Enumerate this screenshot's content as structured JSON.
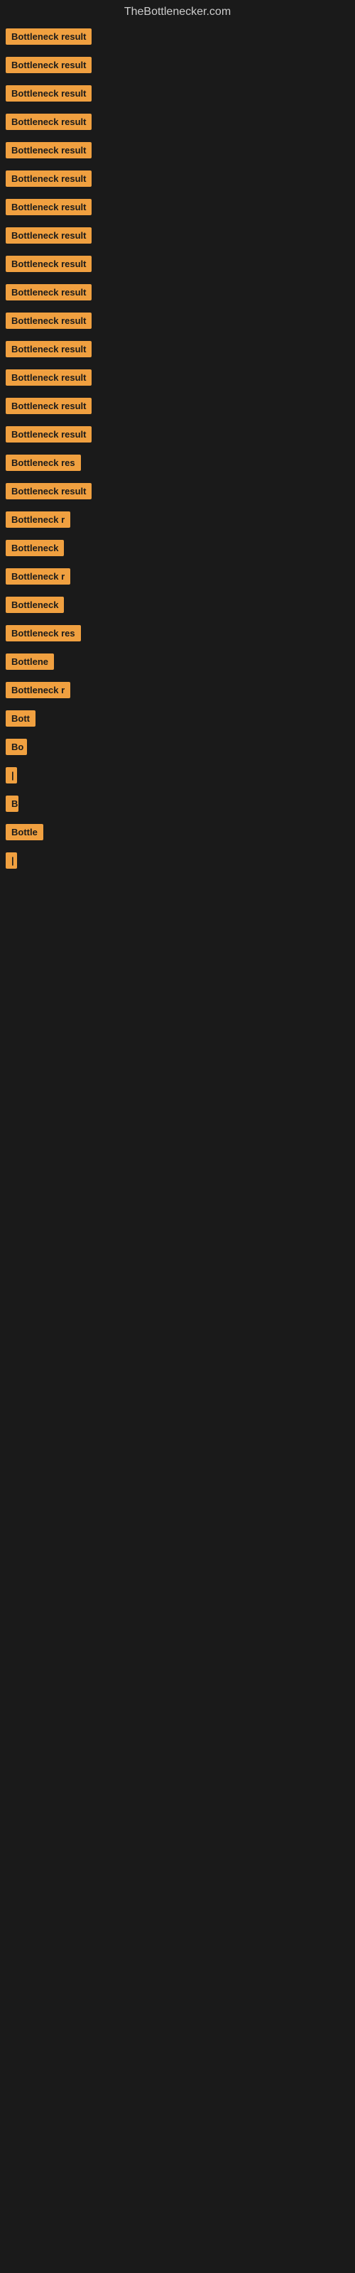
{
  "site": {
    "title": "TheBottlenecker.com"
  },
  "rows": [
    {
      "id": 1,
      "label": "Bottleneck result",
      "width": 145
    },
    {
      "id": 2,
      "label": "Bottleneck result",
      "width": 145
    },
    {
      "id": 3,
      "label": "Bottleneck result",
      "width": 145
    },
    {
      "id": 4,
      "label": "Bottleneck result",
      "width": 145
    },
    {
      "id": 5,
      "label": "Bottleneck result",
      "width": 145
    },
    {
      "id": 6,
      "label": "Bottleneck result",
      "width": 145
    },
    {
      "id": 7,
      "label": "Bottleneck result",
      "width": 145
    },
    {
      "id": 8,
      "label": "Bottleneck result",
      "width": 145
    },
    {
      "id": 9,
      "label": "Bottleneck result",
      "width": 145
    },
    {
      "id": 10,
      "label": "Bottleneck result",
      "width": 145
    },
    {
      "id": 11,
      "label": "Bottleneck result",
      "width": 145
    },
    {
      "id": 12,
      "label": "Bottleneck result",
      "width": 140
    },
    {
      "id": 13,
      "label": "Bottleneck result",
      "width": 140
    },
    {
      "id": 14,
      "label": "Bottleneck result",
      "width": 135
    },
    {
      "id": 15,
      "label": "Bottleneck result",
      "width": 130
    },
    {
      "id": 16,
      "label": "Bottleneck res",
      "width": 115
    },
    {
      "id": 17,
      "label": "Bottleneck result",
      "width": 130
    },
    {
      "id": 18,
      "label": "Bottleneck r",
      "width": 100
    },
    {
      "id": 19,
      "label": "Bottleneck",
      "width": 85
    },
    {
      "id": 20,
      "label": "Bottleneck r",
      "width": 100
    },
    {
      "id": 21,
      "label": "Bottleneck",
      "width": 85
    },
    {
      "id": 22,
      "label": "Bottleneck res",
      "width": 115
    },
    {
      "id": 23,
      "label": "Bottlene",
      "width": 78
    },
    {
      "id": 24,
      "label": "Bottleneck r",
      "width": 100
    },
    {
      "id": 25,
      "label": "Bott",
      "width": 50
    },
    {
      "id": 26,
      "label": "Bo",
      "width": 30
    },
    {
      "id": 27,
      "label": "|",
      "width": 10
    },
    {
      "id": 28,
      "label": "B",
      "width": 18
    },
    {
      "id": 29,
      "label": "Bottle",
      "width": 55
    },
    {
      "id": 30,
      "label": "|",
      "width": 10
    }
  ]
}
